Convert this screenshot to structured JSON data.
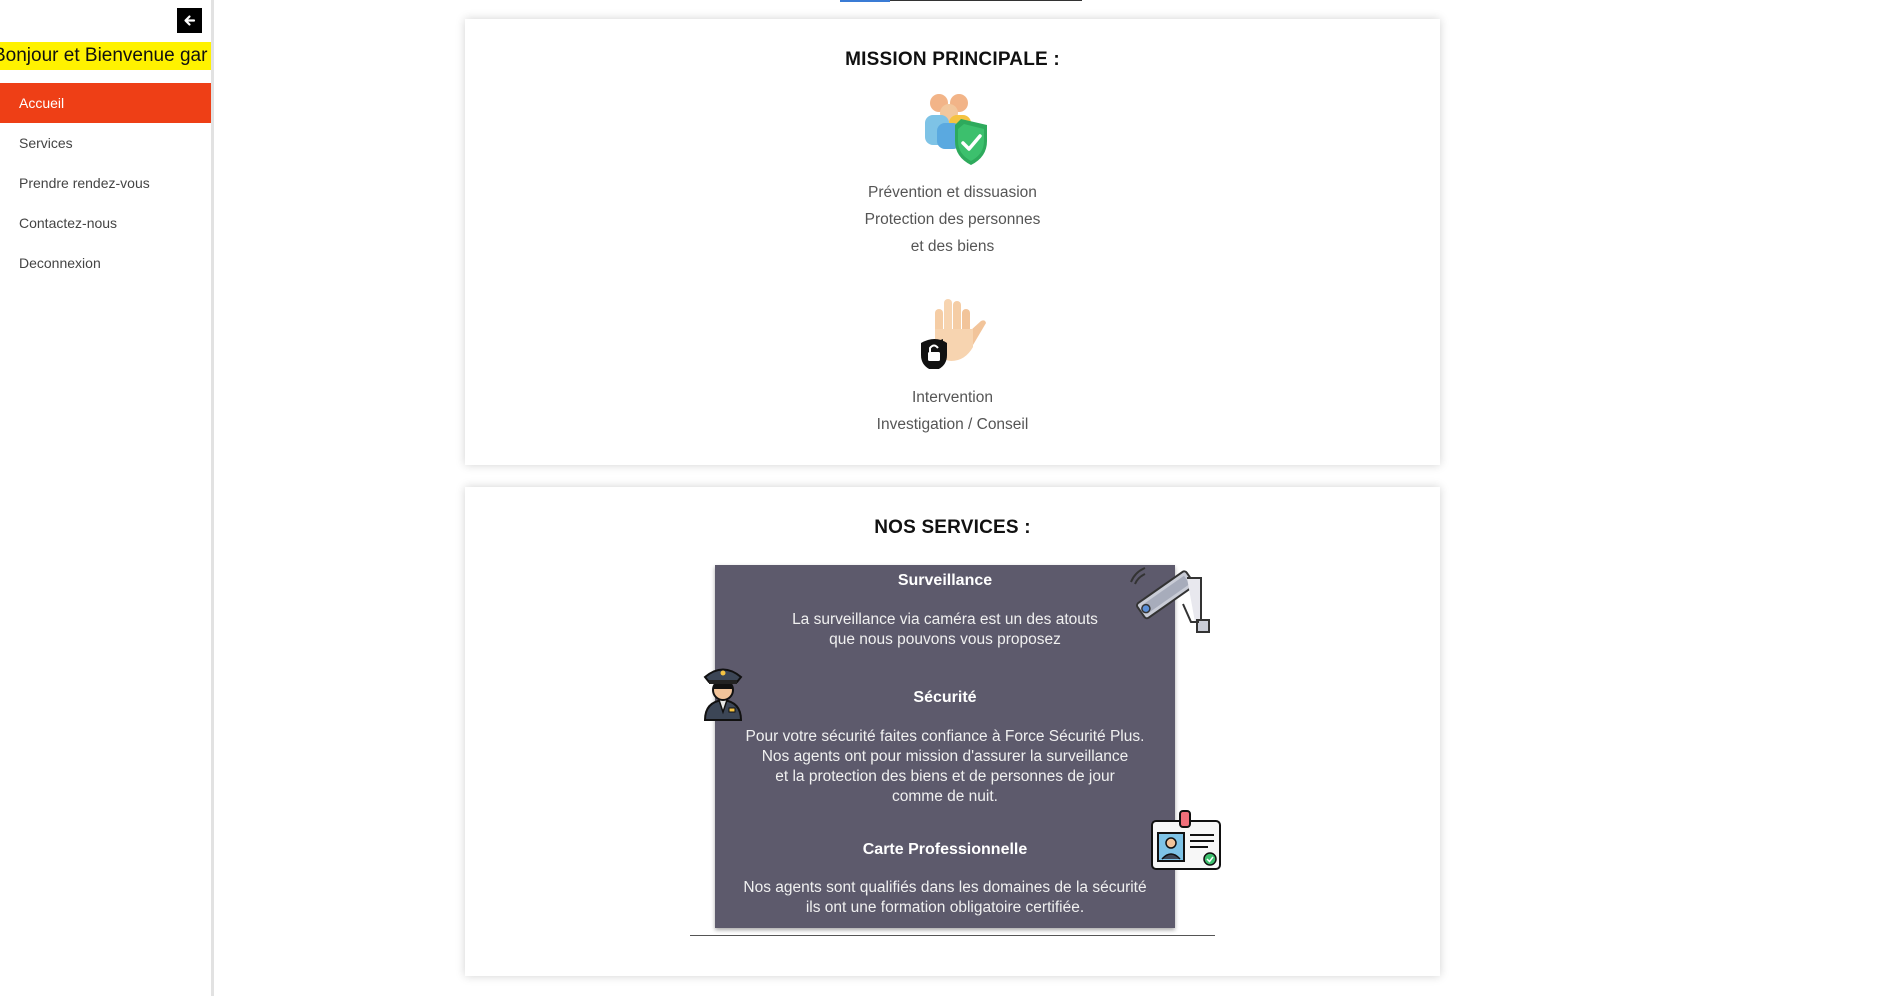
{
  "sidebar": {
    "welcome_text": "Bonjour et Bienvenue gar",
    "items": [
      {
        "label": "Accueil"
      },
      {
        "label": "Services"
      },
      {
        "label": "Prendre rendez-vous"
      },
      {
        "label": "Contactez-nous"
      },
      {
        "label": "Deconnexion"
      }
    ]
  },
  "mission": {
    "title": "MISSION PRINCIPALE :",
    "block1_lines": [
      "Prévention et dissuasion",
      "Protection des personnes",
      "et des biens"
    ],
    "block2_lines": [
      "Intervention",
      "Investigation / Conseil"
    ]
  },
  "services": {
    "title": "NOS SERVICES :",
    "items": [
      {
        "title": "Surveillance",
        "lines": [
          "La surveillance via caméra est un des atouts",
          "que nous pouvons vous proposez"
        ]
      },
      {
        "title": "Sécurité",
        "lines": [
          "Pour votre sécurité faites confiance à Force Sécurité Plus.",
          "Nos agents ont pour mission d'assurer la surveillance",
          "et la protection des biens et de personnes de jour",
          "comme de nuit."
        ]
      },
      {
        "title": "Carte Professionnelle",
        "lines": [
          "Nos agents sont qualifiés dans les domaines de la sécurité",
          "ils ont une formation obligatoire certifiée."
        ]
      }
    ]
  },
  "colors": {
    "accent": "#ee3f16",
    "welcome_bg": "#fff200",
    "services_panel": "#5d5a6c"
  },
  "icons": [
    "arrow-left-icon",
    "people-shield-icon",
    "hand-lock-icon",
    "cctv-camera-icon",
    "security-guard-icon",
    "id-card-icon"
  ]
}
